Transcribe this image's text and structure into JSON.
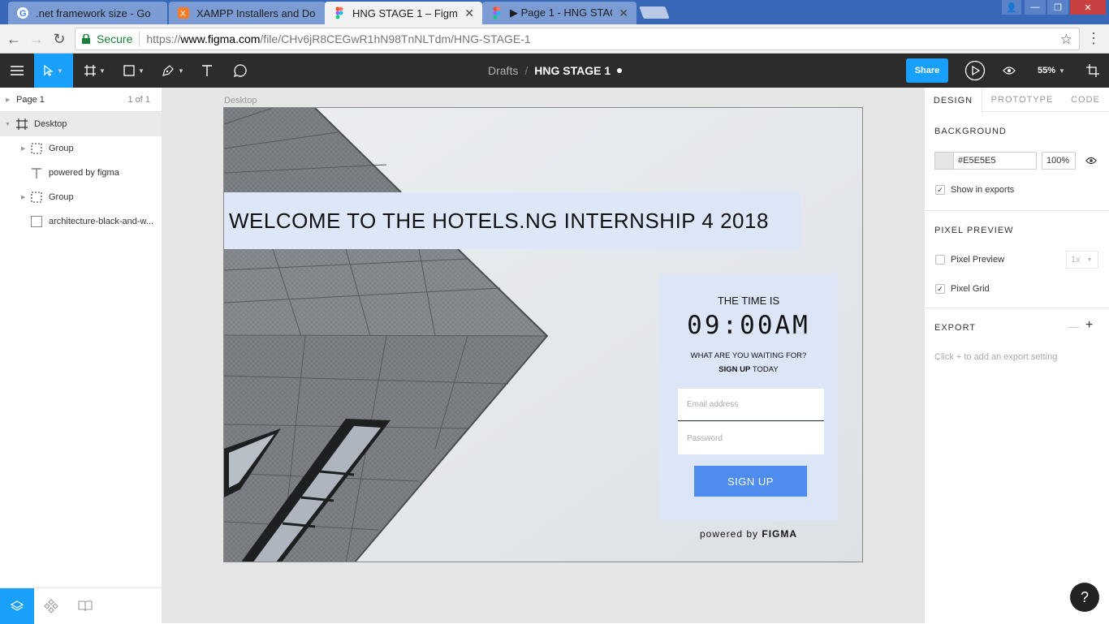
{
  "browser": {
    "tabs": [
      {
        "title": ".net framework size - Go",
        "icon": "google-icon"
      },
      {
        "title": "XAMPP Installers and Do",
        "icon": "xampp-icon"
      },
      {
        "title": "HNG STAGE 1 – Figma",
        "icon": "figma-icon",
        "active": true
      },
      {
        "title": "▶ Page 1 - HNG STAGE",
        "icon": "figma-icon"
      }
    ],
    "secure_label": "Secure",
    "url_scheme": "https://",
    "url_host": "www.figma.com",
    "url_path": "/file/CHv6jR8CEGwR1hN98TnNLTdm/HNG-STAGE-1"
  },
  "toolbar": {
    "drafts": "Drafts",
    "separator": "/",
    "file_name": "HNG STAGE 1",
    "share_label": "Share",
    "zoom": "55%"
  },
  "layers": {
    "page_name": "Page 1",
    "page_count": "1 of 1",
    "items": [
      {
        "name": "Desktop",
        "type": "frame"
      },
      {
        "name": "Group",
        "type": "group"
      },
      {
        "name": "powered by figma",
        "type": "text"
      },
      {
        "name": "Group",
        "type": "group"
      },
      {
        "name": "architecture-black-and-w...",
        "type": "image"
      }
    ]
  },
  "canvas": {
    "frame_label": "Desktop",
    "welcome": "WELCOME TO THE HOTELS.NG INTERNSHIP 4 2018",
    "time_is": "THE TIME IS",
    "clock": "09:00AM",
    "waiting": "WHAT ARE YOU WAITING FOR?",
    "signup_bold": "SIGN UP",
    "signup_rest": " TODAY",
    "email_placeholder": "Email address",
    "password_placeholder": "Password",
    "signup_button": "SIGN UP",
    "powered_by": "powered by ",
    "figma": "FIGMA"
  },
  "design": {
    "tabs": [
      "DESIGN",
      "PROTOTYPE",
      "CODE"
    ],
    "background_title": "BACKGROUND",
    "bg_color": "#E5E5E5",
    "bg_opacity": "100%",
    "show_in_exports": "Show in exports",
    "pixel_preview_title": "PIXEL PREVIEW",
    "pixel_preview": "Pixel Preview",
    "pixel_scale": "1x",
    "pixel_grid": "Pixel Grid",
    "export_title": "EXPORT",
    "export_hint": "Click + to add an export setting"
  },
  "colors": {
    "figma_blue": "#18A0FB",
    "signup_blue": "#4E8DED",
    "card_bg": "#DCE6F7",
    "toolbar_dark": "#2C2C2C"
  },
  "help_label": "?"
}
